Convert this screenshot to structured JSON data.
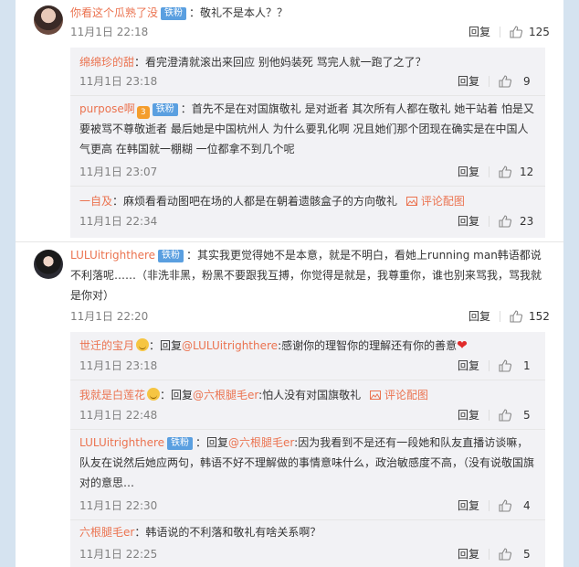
{
  "threads": [
    {
      "user": "你看这个瓜熟了没",
      "badge": "铁粉",
      "text": "：敬礼不是本人？？",
      "time": "11月1日 22:18",
      "reply_label": "回复",
      "likes": "125",
      "replies": [
        {
          "user": "绵绵珍的甜",
          "text": "：看完澄清就滚出来回应 别他妈装死 骂完人就一跑了之了？",
          "time": "11月1日 23:18",
          "reply_label": "回复",
          "likes": "9"
        },
        {
          "user": "purpose啊",
          "vip": "3",
          "badge": "铁粉",
          "text": "：首先不是在对国旗敬礼 是对逝者 其次所有人都在敬礼 她干站着 怕是又要被骂不尊敬逝者 最后她是中国杭州人 为什么要乳化啊 况且她们那个团现在确实是在中国人气更高 在韩国就一棚糊 一位都拿不到几个呢",
          "time": "11月1日 23:07",
          "reply_label": "回复",
          "likes": "12"
        },
        {
          "user": "一自及",
          "text": "：麻烦看看动图吧在场的人都是在朝着遗骸盒子的方向敬礼",
          "pic_label": "评论配图",
          "time": "11月1日 22:34",
          "reply_label": "回复",
          "likes": "23"
        }
      ]
    },
    {
      "user": "LULUitrighthere",
      "badge": "铁粉",
      "text": "：其实我更觉得她不是本意，就是不明白，看她上running man韩语都说不利落呢……（非洗非黑，粉黑不要跟我互搏，你觉得是就是，我尊重你，谁也别来骂我，骂我就是你对）",
      "time": "11月1日 22:20",
      "reply_label": "回复",
      "likes": "152",
      "replies": [
        {
          "user": "世迁的宝月",
          "prefix": "：回复",
          "mention": "@LULUitrighthere",
          "text": ":感谢你的理智你的理解还有你的善意",
          "time": "11月1日 23:18",
          "reply_label": "回复",
          "likes": "1"
        },
        {
          "user": "我就是白莲花",
          "prefix": "：回复",
          "mention": "@六根腿毛er",
          "text": ":怕人没有对国旗敬礼",
          "pic_label": "评论配图",
          "time": "11月1日 22:48",
          "reply_label": "回复",
          "likes": "5"
        },
        {
          "user": "LULUitrighthere",
          "badge": "铁粉",
          "prefix": "：回复",
          "mention": "@六根腿毛er",
          "text": ":因为我看到不是还有一段她和队友直播访谈嘛，队友在说然后她应两句，韩语不好不理解做的事情意味什么，政治敏感度不高，（没有说敬国旗对的意思…",
          "time": "11月1日 22:30",
          "reply_label": "回复",
          "likes": "4"
        },
        {
          "user": "六根腿毛er",
          "text": "：韩语说的不利落和敬礼有啥关系啊？",
          "time": "11月1日 22:25",
          "reply_label": "回复",
          "likes": "5"
        }
      ]
    }
  ]
}
